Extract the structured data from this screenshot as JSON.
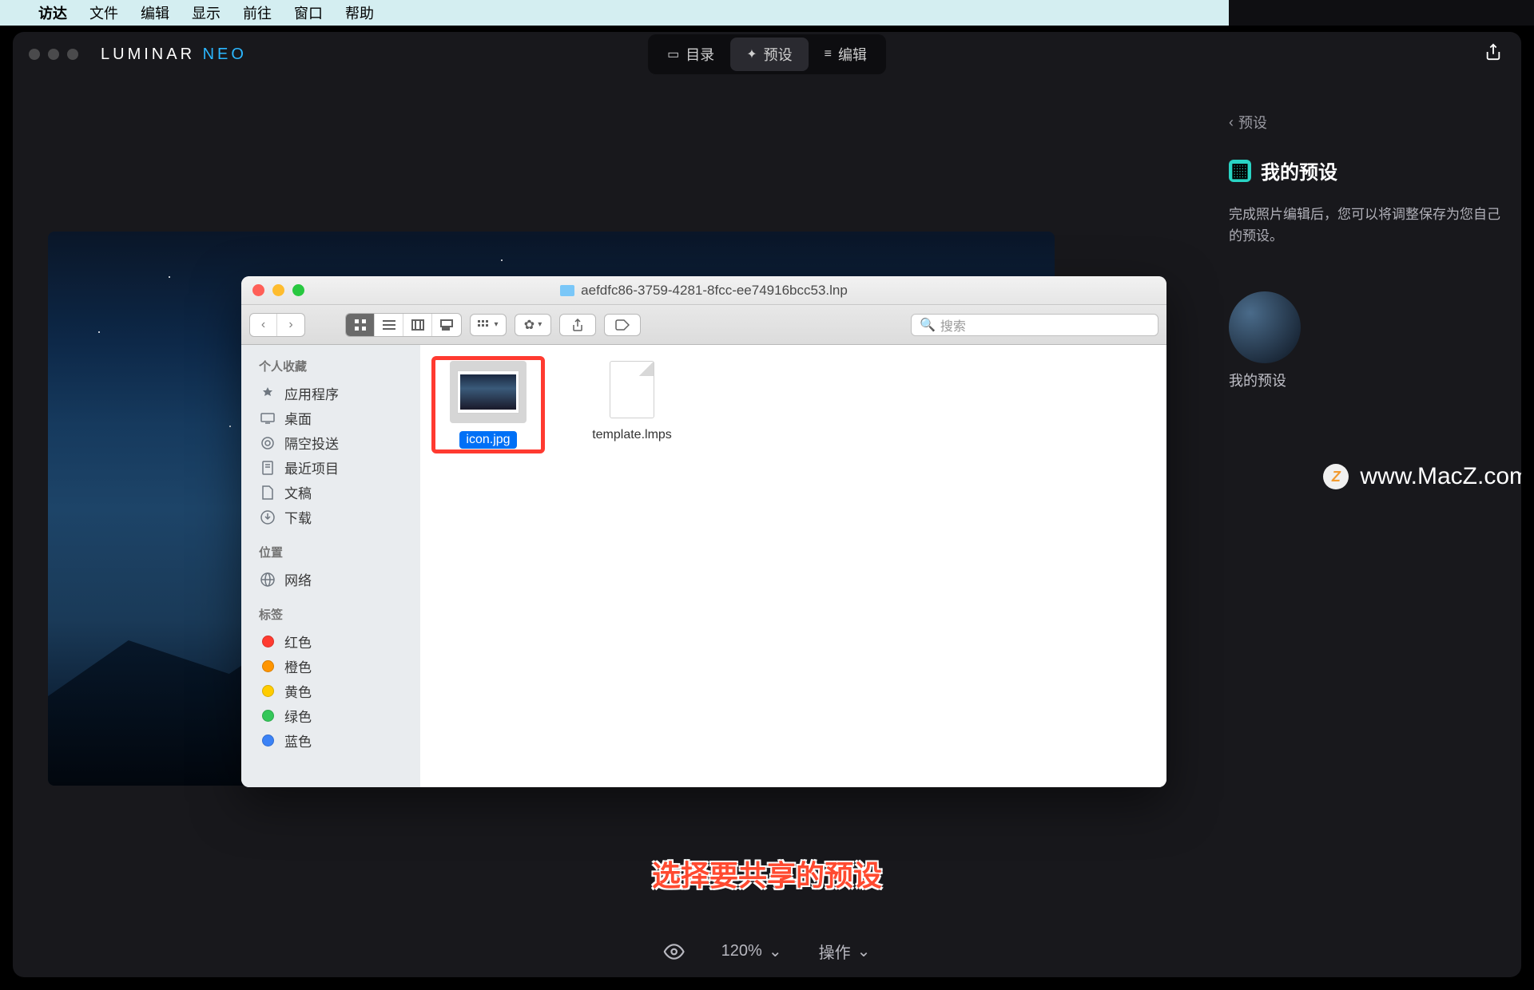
{
  "menubar": {
    "app": "访达",
    "items": [
      "文件",
      "编辑",
      "显示",
      "前往",
      "窗口",
      "帮助"
    ]
  },
  "app": {
    "logo_main": "LUMINAR",
    "logo_accent": "NEO",
    "modes": [
      {
        "icon": "▭",
        "label": "目录"
      },
      {
        "icon": "✦",
        "label": "预设"
      },
      {
        "icon": "≡",
        "label": "编辑"
      }
    ],
    "active_mode": 1
  },
  "panel": {
    "back_label": "预设",
    "title": "我的预设",
    "description": "完成照片编辑后，您可以将调整保存为您自己的预设。",
    "preset_label": "我的预设"
  },
  "watermark": {
    "icon": "Z",
    "text": "www.MacZ.com"
  },
  "finder": {
    "title": "aefdfc86-3759-4281-8fcc-ee74916bcc53.lnp",
    "search_placeholder": "搜索",
    "sidebar": {
      "favorites_heading": "个人收藏",
      "favorites": [
        {
          "icon": "apps",
          "label": "应用程序"
        },
        {
          "icon": "desktop",
          "label": "桌面"
        },
        {
          "icon": "airdrop",
          "label": "隔空投送"
        },
        {
          "icon": "recents",
          "label": "最近项目"
        },
        {
          "icon": "documents",
          "label": "文稿"
        },
        {
          "icon": "downloads",
          "label": "下载"
        }
      ],
      "locations_heading": "位置",
      "locations": [
        {
          "icon": "network",
          "label": "网络"
        }
      ],
      "tags_heading": "标签",
      "tags": [
        {
          "color": "red",
          "label": "红色"
        },
        {
          "color": "orange",
          "label": "橙色"
        },
        {
          "color": "yellow",
          "label": "黄色"
        },
        {
          "color": "green",
          "label": "绿色"
        },
        {
          "color": "blue",
          "label": "蓝色"
        }
      ]
    },
    "files": [
      {
        "name": "icon.jpg",
        "kind": "image",
        "selected": true,
        "highlighted": true
      },
      {
        "name": "template.lmps",
        "kind": "file",
        "selected": false,
        "highlighted": false
      }
    ]
  },
  "caption": "选择要共享的预设",
  "bottom": {
    "zoom": "120%",
    "action": "操作"
  }
}
